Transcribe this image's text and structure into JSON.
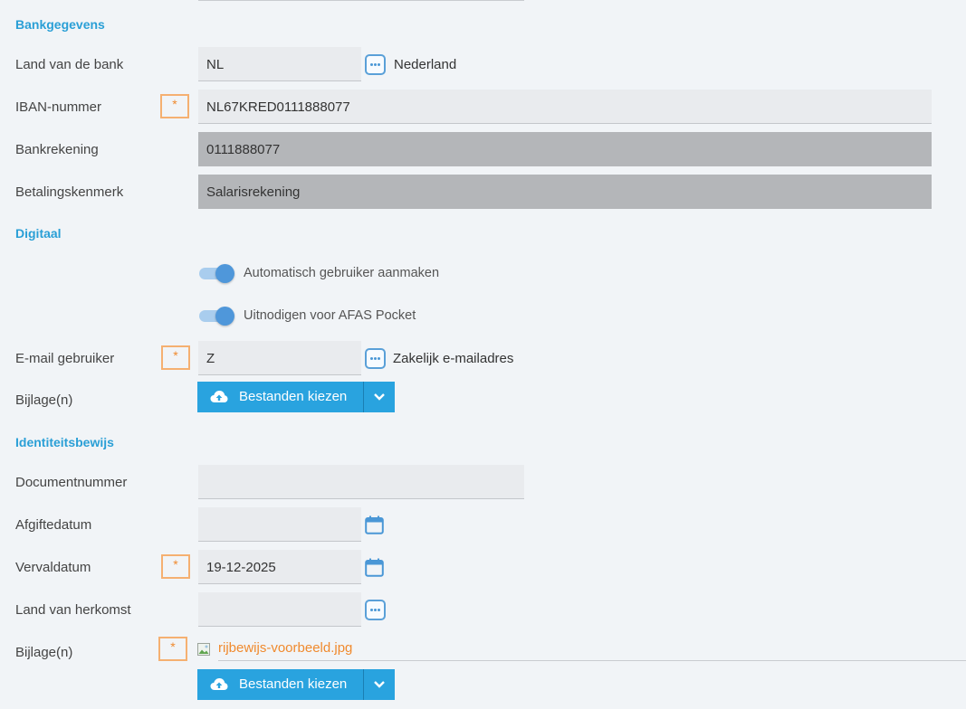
{
  "sections": {
    "bank": "Bankgegevens",
    "digital": "Digitaal",
    "identity": "Identiteitsbewijs"
  },
  "required_marker": "*",
  "bank": {
    "country_label": "Land van de bank",
    "country_value": "NL",
    "country_name": "Nederland",
    "iban_label": "IBAN-nummer",
    "iban_value": "NL67KRED0111888077",
    "account_label": "Bankrekening",
    "account_value": "0111888077",
    "reference_label": "Betalingskenmerk",
    "reference_value": "Salarisrekening"
  },
  "digital": {
    "toggle_auto_user": "Automatisch gebruiker aanmaken",
    "toggle_auto_user_on": true,
    "toggle_invite": "Uitnodigen voor AFAS Pocket",
    "toggle_invite_on": true,
    "email_label": "E-mail gebruiker",
    "email_value": "Z",
    "email_type": "Zakelijk e-mailadres",
    "attachments_label": "Bijlage(n)",
    "upload_button": "Bestanden kiezen"
  },
  "identity": {
    "docnum_label": "Documentnummer",
    "docnum_value": "",
    "issue_label": "Afgiftedatum",
    "issue_value": "",
    "expiry_label": "Vervaldatum",
    "expiry_value": "19-12-2025",
    "origin_label": "Land van herkomst",
    "origin_value": "",
    "attachments_label": "Bijlage(n)",
    "file_name": "rijbewijs-voorbeeld.jpg",
    "upload_button": "Bestanden kiezen"
  },
  "colors": {
    "accent": "#29a3df",
    "required": "#f08a2e",
    "section": "#2a9fd6"
  }
}
